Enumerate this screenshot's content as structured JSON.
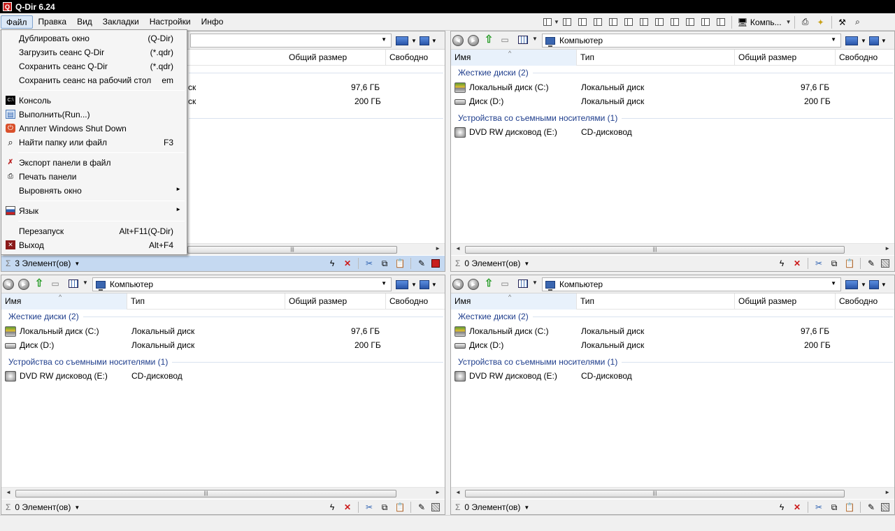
{
  "window": {
    "title": "Q-Dir 6.24"
  },
  "menubar": {
    "items": [
      "Файл",
      "Правка",
      "Вид",
      "Закладки",
      "Настройки",
      "Инфо"
    ]
  },
  "toolbar": {
    "address_label": "Компь..."
  },
  "file_menu": {
    "items": [
      {
        "label": "Дублировать окно",
        "accel": "(Q-Dir)"
      },
      {
        "label": "Загрузить сеанс Q-Dir",
        "accel": "(*.qdr)"
      },
      {
        "label": "Сохранить сеанс Q-Dir",
        "accel": "(*.qdr)"
      },
      {
        "label": "Сохранить сеанс на рабочий стол",
        "accel": "em"
      },
      {
        "label": "Консоль",
        "accel": ""
      },
      {
        "label": "Выполнить(Run...)",
        "accel": ""
      },
      {
        "label": "Апплет Windows Shut Down",
        "accel": ""
      },
      {
        "label": "Найти папку или файл",
        "accel": "F3"
      },
      {
        "label": "Экспорт панели в файл",
        "accel": ""
      },
      {
        "label": "Печать панели",
        "accel": ""
      },
      {
        "label": "Выровнять окно",
        "accel": ""
      },
      {
        "label": "Язык",
        "accel": ""
      },
      {
        "label": "Перезапуск",
        "accel": "Alt+F11(Q-Dir)"
      },
      {
        "label": "Выход",
        "accel": "Alt+F4"
      }
    ]
  },
  "columns": [
    "Имя",
    "Тип",
    "Общий размер",
    "Свободно"
  ],
  "address": "Компьютер",
  "groups": [
    "Жесткие диски (2)",
    "Устройства со съемными носителями (1)"
  ],
  "drives": [
    {
      "name": "Локальный диск (C:)",
      "type": "Локальный диск",
      "size": "97,6 ГБ"
    },
    {
      "name": "Диск (D:)",
      "type": "Локальный диск",
      "size": "200 ГБ"
    },
    {
      "name": "DVD RW дисковод (E:)",
      "type": "CD-дисковод",
      "size": ""
    }
  ],
  "panes": [
    {
      "status": "3 Элемент(ов)",
      "active": true
    },
    {
      "status": "0 Элемент(ов)",
      "active": false
    },
    {
      "status": "0 Элемент(ов)",
      "active": false
    },
    {
      "status": "0 Элемент(ов)",
      "active": false
    }
  ],
  "colors": {
    "active_status": "#c5d9f1",
    "group_text": "#1e3d8c",
    "titlebar": "#000000"
  }
}
